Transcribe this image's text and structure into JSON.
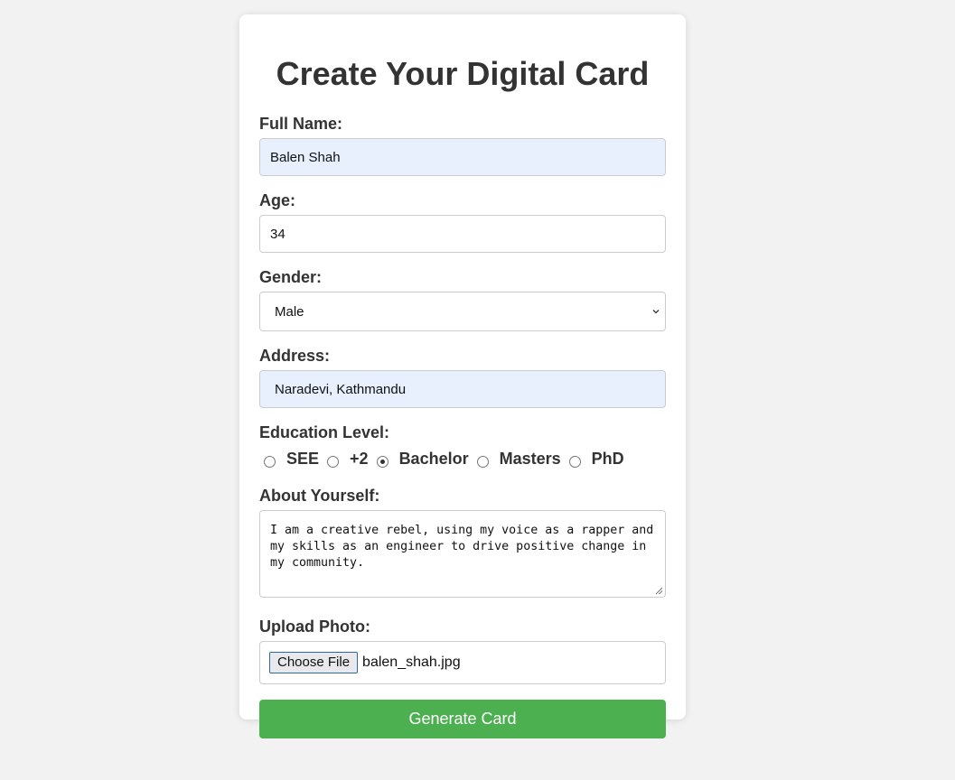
{
  "form": {
    "title": "Create Your Digital Card",
    "full_name": {
      "label": "Full Name:",
      "value": "Balen Shah"
    },
    "age": {
      "label": "Age:",
      "value": "34"
    },
    "gender": {
      "label": "Gender:",
      "selected": "Male"
    },
    "address": {
      "label": "Address:",
      "value": "Naradevi, Kathmandu"
    },
    "education": {
      "label": "Education Level:",
      "options": [
        "SEE",
        "+2",
        "Bachelor",
        "Masters",
        "PhD"
      ],
      "selected": "Bachelor"
    },
    "about": {
      "label": "About Yourself:",
      "value": "I am a creative rebel, using my voice as a rapper and my skills as an engineer to drive positive change in my community."
    },
    "photo": {
      "label": "Upload Photo:",
      "button_label": "Choose File",
      "file_name": "balen_shah.jpg"
    },
    "submit_label": "Generate Card"
  },
  "colors": {
    "background": "#f2f2f2",
    "card": "#ffffff",
    "autofill": "#e8f0fe",
    "submit": "#4caf50",
    "text": "#333333"
  },
  "icons": {
    "select": "chevron-down-icon",
    "textarea": "resize-handle-icon"
  }
}
